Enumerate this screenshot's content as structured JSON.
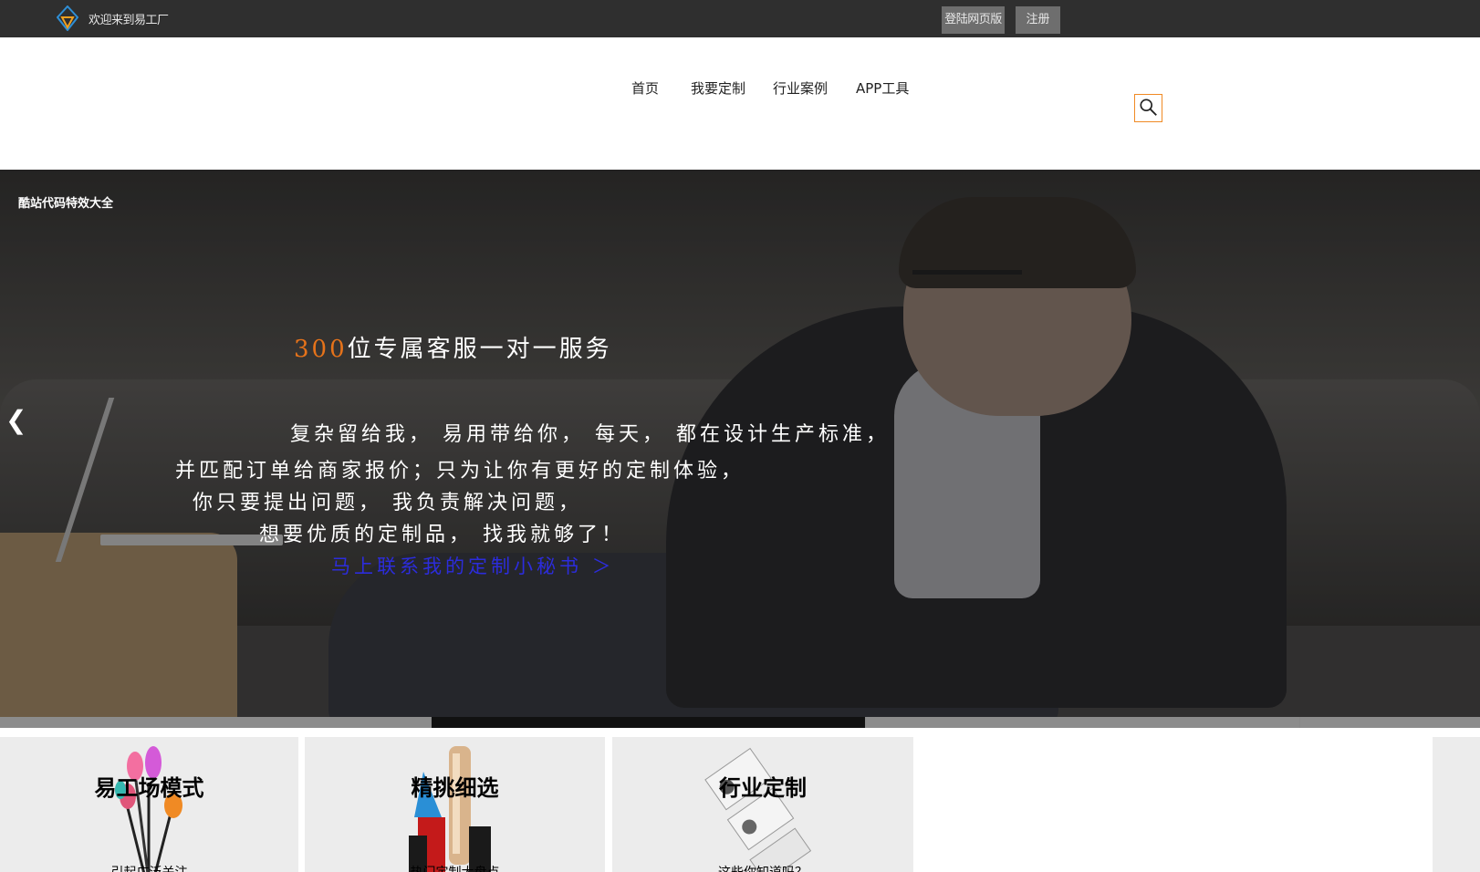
{
  "topbar": {
    "logo_icon": "diamond-logo-icon",
    "welcome": "欢迎来到易工厂",
    "login": "登陆网页版",
    "register": "注册"
  },
  "nav": {
    "items": [
      "首页",
      "我要定制",
      "行业案例",
      "APP工具"
    ],
    "search_icon": "search-icon",
    "accent_color": "#f08a24"
  },
  "hero": {
    "badge": "酷站代码特效大全",
    "headline_highlight": "300",
    "headline_rest": "位专属客服一对一服务",
    "line1": "复杂留给我， 易用带给你， 每天， 都在设计生产标准，",
    "line2": "并匹配订单给商家报价；只为让你有更好的定制体验，",
    "line3": "你只要提出问题， 我负责解决问题，",
    "line4": "想要优质的定制品， 找我就够了！",
    "cta": "马上联系我的定制小秘书 ＞",
    "prev_arrow": "❮"
  },
  "cards": [
    {
      "title": "易工场模式",
      "subtitle": "引起广泛关注"
    },
    {
      "title": "精挑细选",
      "subtitle": "热门定制大盘点"
    },
    {
      "title": "行业定制",
      "subtitle": "这些你知道吗？"
    }
  ]
}
